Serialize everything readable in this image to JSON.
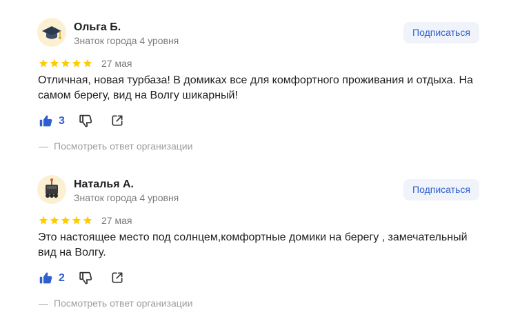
{
  "reviews": [
    {
      "author": "Ольга Б.",
      "level": "Знаток города 4 уровня",
      "subscribe_label": "Подписаться",
      "rating": 5,
      "date": "27 мая",
      "text": "Отличная, новая турбаза! В домиках все для комфортного проживания и отдыха. На самом берегу, вид на Волгу шикарный!",
      "likes": "3",
      "avatar_icon": "graduation-cap-icon",
      "org_reply_dash": "—",
      "org_reply_label": "Посмотреть ответ организации"
    },
    {
      "author": "Наталья А.",
      "level": "Знаток города 4 уровня",
      "subscribe_label": "Подписаться",
      "rating": 5,
      "date": "27 мая",
      "text": "Это настоящее место под солнцем,комфортные домики на берегу , замечательный вид на Волгу.",
      "likes": "2",
      "avatar_icon": "delivery-robot-icon",
      "org_reply_dash": "—",
      "org_reply_label": "Посмотреть ответ организации"
    }
  ],
  "colors": {
    "star": "#fc0",
    "accent": "#2f5fcf",
    "secondary_text": "#7a7a7a",
    "subscribe_bg": "#f0f4fa"
  },
  "icons": {
    "like": "thumbs-up-icon",
    "dislike": "thumbs-down-icon",
    "share": "share-icon",
    "star": "star-icon"
  }
}
